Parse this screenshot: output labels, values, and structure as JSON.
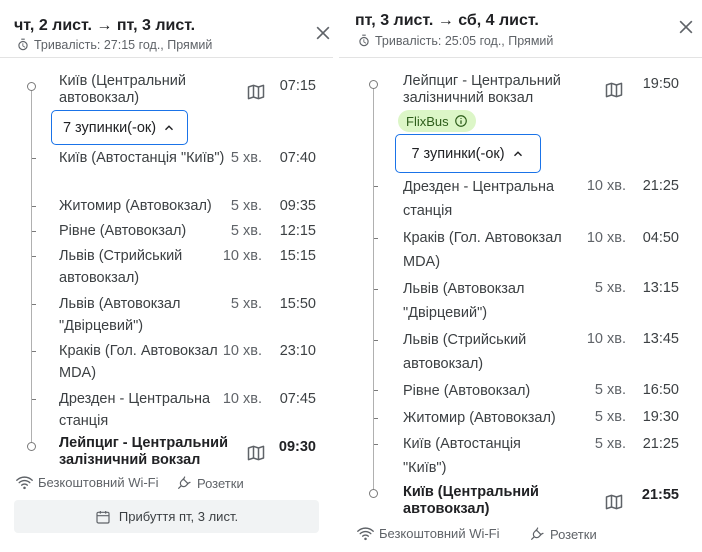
{
  "left": {
    "title": "чт, 2 лист. → пт, 3 лист.",
    "duration": "Тривалість: 27:15 год., Прямий",
    "departure": {
      "name": "Київ (Центральний автовокзал)",
      "time": "07:15"
    },
    "stops_toggle": "7 зупинки(-ок)",
    "stops": [
      {
        "name": "Київ (Автостанція \"Київ\")",
        "dur": "5 хв.",
        "time": "07:40"
      },
      {
        "name": "Житомир (Автовокзал)",
        "dur": "5 хв.",
        "time": "09:35"
      },
      {
        "name": "Рівне (Автовокзал)",
        "dur": "5 хв.",
        "time": "12:15"
      },
      {
        "name": "Львів (Стрийський автовокзал)",
        "dur": "10 хв.",
        "time": "15:15"
      },
      {
        "name": "Львів (Автовокзал \"Двірцевий\")",
        "dur": "5 хв.",
        "time": "15:50"
      },
      {
        "name": "Краків (Гол. Автовокзал MDA)",
        "dur": "10 хв.",
        "time": "23:10"
      },
      {
        "name": "Дрезден - Центральна станція",
        "dur": "10 хв.",
        "time": "07:45"
      }
    ],
    "arrival": {
      "name": "Лейпциг - Центральний залізничний вокзал",
      "time": "09:30"
    },
    "amenities": {
      "wifi": "Безкоштовний Wi-Fi",
      "sockets": "Розетки"
    },
    "arrival_note": "Прибуття пт, 3 лист."
  },
  "right": {
    "title": "пт, 3 лист. → сб, 4 лист.",
    "duration": "Тривалість: 25:05 год., Прямий",
    "departure": {
      "name": "Лейпциг - Центральний залізничний вокзал",
      "time": "19:50"
    },
    "carrier": "FlixBus",
    "stops_toggle": "7 зупинки(-ок)",
    "stops": [
      {
        "name": "Дрезден - Центральна станція",
        "dur": "10 хв.",
        "time": "21:25"
      },
      {
        "name": "Краків (Гол. Автовокзал MDA)",
        "dur": "10 хв.",
        "time": "04:50"
      },
      {
        "name": "Львів (Автовокзал \"Двірцевий\")",
        "dur": "5 хв.",
        "time": "13:15"
      },
      {
        "name": "Львів (Стрийський автовокзал)",
        "dur": "10 хв.",
        "time": "13:45"
      },
      {
        "name": "Рівне (Автовокзал)",
        "dur": "5 хв.",
        "time": "16:50"
      },
      {
        "name": "Житомир (Автовокзал)",
        "dur": "5 хв.",
        "time": "19:30"
      },
      {
        "name": "Київ (Автостанція \"Київ\")",
        "dur": "5 хв.",
        "time": "21:25"
      }
    ],
    "arrival": {
      "name": "Київ (Центральний автовокзал)",
      "time": "21:55"
    },
    "amenities": {
      "wifi": "Безкоштовний Wi-Fi",
      "sockets": "Розетки"
    }
  },
  "colors": {
    "accent_blue": "#1a73e8",
    "carrier_badge_bg": "#dcf6c7",
    "text_dark": "#202124",
    "text_muted": "#5f6368"
  },
  "icons": {
    "close": "close-icon",
    "timer": "timer-icon",
    "map": "map-icon",
    "chevron": "chevron-up-icon",
    "info": "info-icon",
    "wifi": "wifi-icon",
    "plug": "power-plug-icon",
    "calendar": "calendar-icon"
  }
}
